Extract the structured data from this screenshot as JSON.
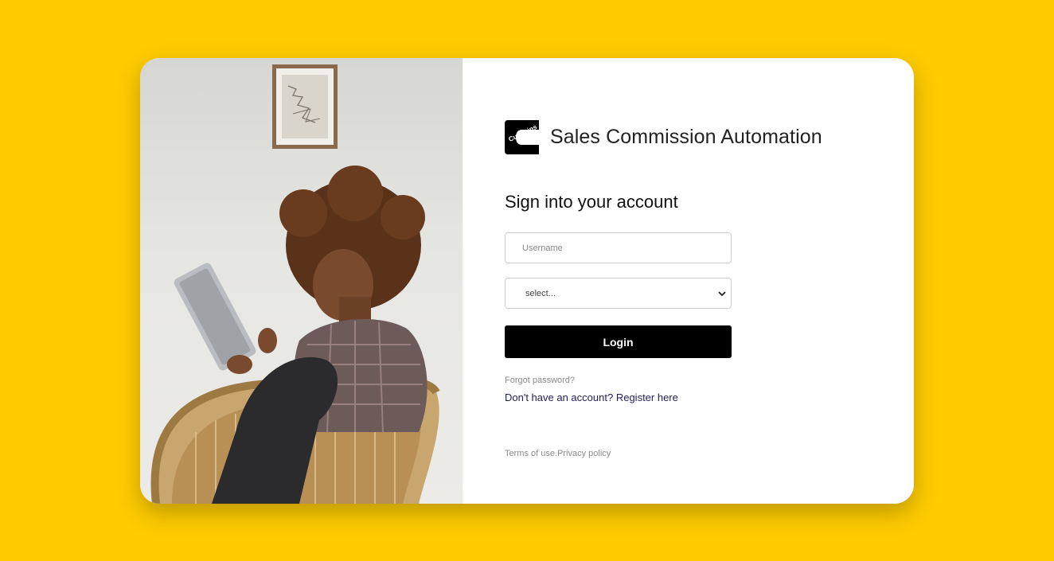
{
  "app": {
    "title": "Sales Commission Automation",
    "logo_text": "Cummins"
  },
  "login": {
    "heading": "Sign into your account",
    "username_placeholder": "Username",
    "select_value": "select...",
    "login_label": "Login",
    "forgot_password": "Forgot password?",
    "register_prompt": "Don't have an account?",
    "register_link": "Register here",
    "terms": "Terms of use.",
    "privacy": "Privacy policy"
  },
  "colors": {
    "background": "#ffcc00",
    "button": "#000000",
    "link": "#1f1f5c"
  },
  "icons": {
    "logo": "cummins-logo-icon",
    "select_arrow": "chevron-down-icon"
  }
}
